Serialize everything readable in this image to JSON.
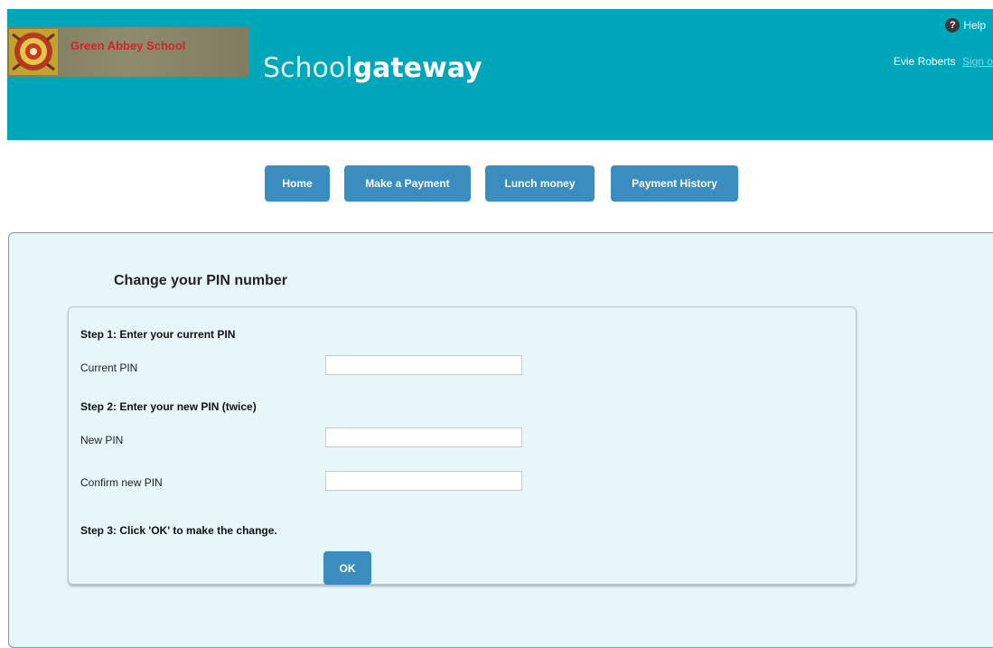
{
  "header": {
    "school_name": "Green Abbey School",
    "brand_light": "Scho",
    "brand_oo": "ol",
    "brand_bold": "gateway",
    "help_label": "Help",
    "help_icon": "question-icon",
    "user_name": "Evie Roberts",
    "sign_out_label": "Sign out"
  },
  "nav": {
    "home": "Home",
    "make_payment": "Make a Payment",
    "lunch_money": "Lunch money",
    "payment_history": "Payment History"
  },
  "main": {
    "title": "Change your PIN number",
    "step1": "Step 1: Enter your current PIN",
    "current_pin_label": "Current PIN",
    "current_pin_value": "",
    "step2": "Step 2: Enter your new PIN (twice)",
    "new_pin_label": "New PIN",
    "new_pin_value": "",
    "confirm_pin_label": "Confirm new PIN",
    "confirm_pin_value": "",
    "step3": "Step 3: Click 'OK' to make the change.",
    "ok_label": "OK"
  },
  "colors": {
    "header_bg": "#00a7bb",
    "button_bg": "#3b8dc0",
    "panel_bg": "#e6f6f9",
    "school_name": "#d3222a"
  }
}
